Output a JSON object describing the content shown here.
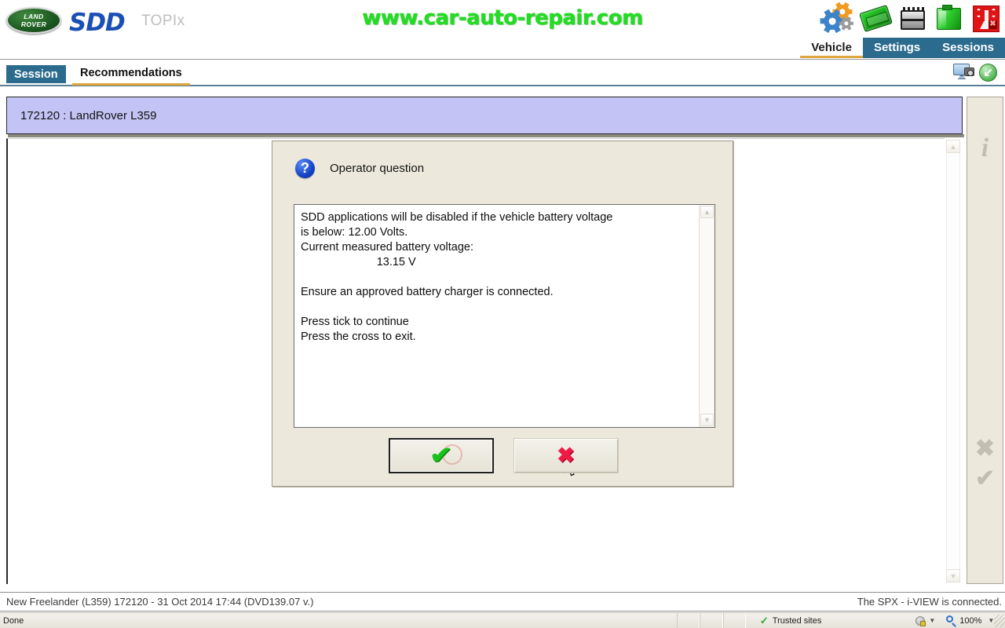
{
  "header": {
    "brand_logo_line1": "LAND",
    "brand_logo_line2": "ROVER",
    "app_name": "SDD",
    "portal_name": "TOPIx",
    "watermark": "www.car-auto-repair.com",
    "icons": [
      {
        "name": "settings-gears-icon"
      },
      {
        "name": "vci-module-icon"
      },
      {
        "name": "battery-icon"
      },
      {
        "name": "fluid-container-icon"
      },
      {
        "name": "wireless-disconnected-icon"
      }
    ],
    "tabs": [
      {
        "label": "Vehicle",
        "selected": true
      },
      {
        "label": "Settings",
        "selected": false
      },
      {
        "label": "Sessions",
        "selected": false
      }
    ]
  },
  "tabbar": {
    "tabs": [
      {
        "label": "Session",
        "active": true
      },
      {
        "label": "Recommendations",
        "active": false
      }
    ],
    "tools": [
      {
        "name": "screenshot-icon"
      },
      {
        "name": "back-icon",
        "glyph": "↙"
      }
    ]
  },
  "session": {
    "title": "172120 : LandRover L359"
  },
  "dialog": {
    "icon_glyph": "?",
    "title": "Operator question",
    "message": "SDD applications will be disabled if the vehicle battery voltage\nis below: 12.00 Volts.\nCurrent measured battery voltage:\n                        13.15 V\n\nEnsure an approved battery charger is connected.\n\nPress tick to continue\nPress the cross to exit.",
    "min_voltage": "12.00 Volts",
    "measured_voltage": "13.15 V",
    "scroll_up_glyph": "▲",
    "scroll_down_glyph": "▼",
    "buttons": [
      {
        "name": "confirm-button",
        "glyph": "✔",
        "focused": true
      },
      {
        "name": "cancel-button",
        "glyph": "✖",
        "focused": false
      }
    ]
  },
  "side_panel": {
    "buttons": [
      {
        "name": "info-button",
        "glyph": "i",
        "enabled": false
      },
      {
        "name": "cross-button",
        "glyph": "✖",
        "enabled": false
      },
      {
        "name": "tick-button",
        "glyph": "✔",
        "enabled": false
      }
    ]
  },
  "content_scroll": {
    "up_glyph": "▲",
    "down_glyph": "▼"
  },
  "footer": {
    "left": "New Freelander (L359) 172120 - 31 Oct 2014 17:44 (DVD139.07 v.)",
    "right": "The SPX - i-VIEW is connected."
  },
  "statusbar": {
    "status": "Done",
    "zone": "Trusted sites",
    "zone_check_glyph": "✓",
    "caret_glyph": "▼",
    "zoom": "100%"
  },
  "colors": {
    "accent_blue": "#2b6b8d",
    "accent_orange": "#e0a63e",
    "dialog_bg": "#ece8dc",
    "session_bar_bg": "#c3c3f5",
    "watermark_green": "#22dd22",
    "tick_green": "#19c219",
    "cross_red": "#ee1a45"
  }
}
